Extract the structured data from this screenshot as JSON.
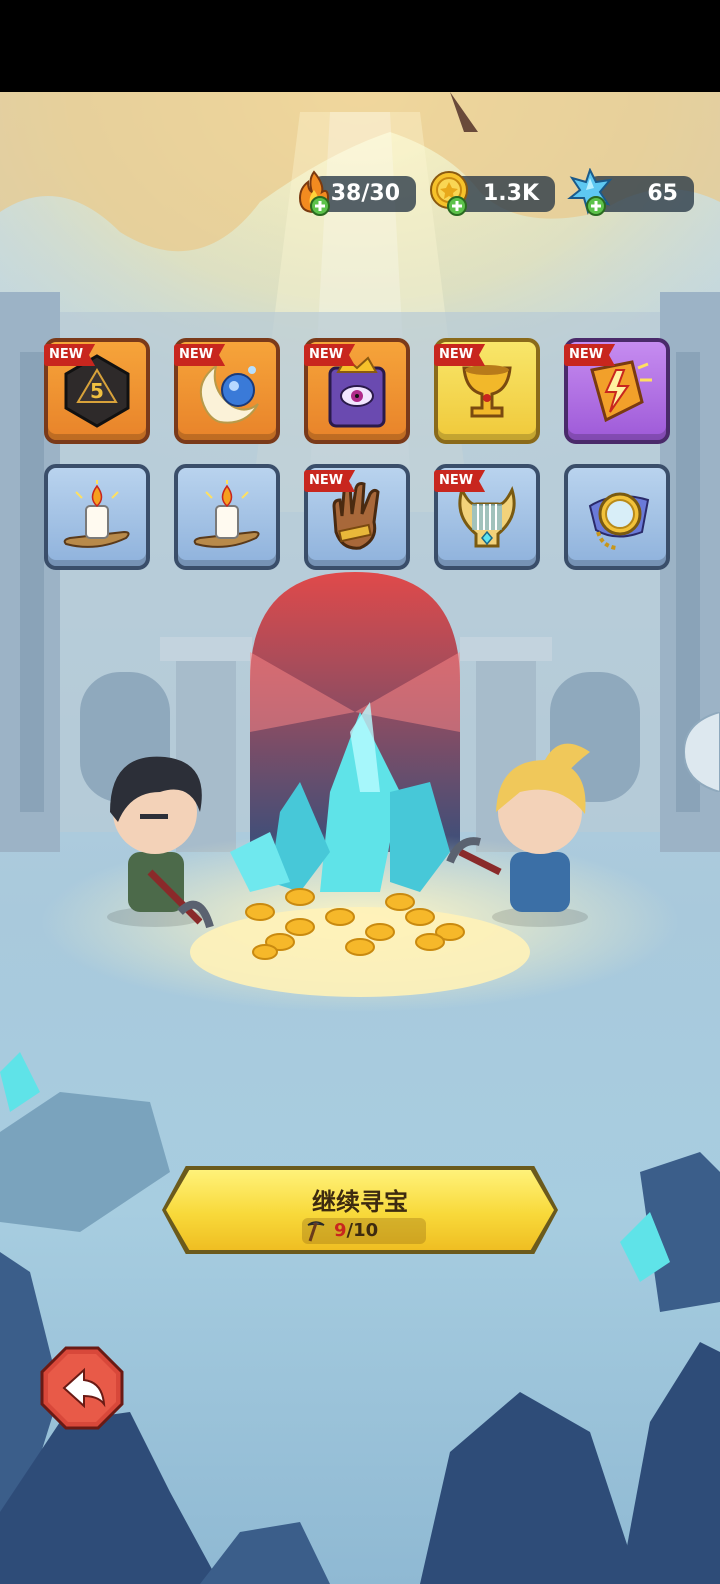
{
  "resources": {
    "energy": {
      "value": "38/30",
      "icon": "fire-icon"
    },
    "gold": {
      "value": "1.3K",
      "icon": "coin-icon"
    },
    "gems": {
      "value": "65",
      "icon": "crystal-icon"
    }
  },
  "items": [
    {
      "name": "d20-dice",
      "rarity": "orange",
      "badge": "NEW"
    },
    {
      "name": "moon-orb",
      "rarity": "orange",
      "badge": "NEW"
    },
    {
      "name": "eye-tome",
      "rarity": "orange",
      "badge": "NEW"
    },
    {
      "name": "golden-goblet",
      "rarity": "yellow",
      "badge": "NEW"
    },
    {
      "name": "lightning-shield",
      "rarity": "purple",
      "badge": "NEW"
    },
    {
      "name": "candle",
      "rarity": "blue",
      "badge": ""
    },
    {
      "name": "candle",
      "rarity": "blue",
      "badge": ""
    },
    {
      "name": "leather-glove",
      "rarity": "blue",
      "badge": "NEW"
    },
    {
      "name": "golden-lyre",
      "rarity": "blue",
      "badge": "NEW"
    },
    {
      "name": "pocket-mirror",
      "rarity": "blue",
      "badge": ""
    }
  ],
  "badge_text": "NEW",
  "continue_button": {
    "label": "继续寻宝",
    "current": "9",
    "sep_total": "/10"
  },
  "colors": {
    "accent_yellow": "#f8d93a",
    "badge_red": "#c8261e",
    "pill_dark": "#28374680"
  }
}
